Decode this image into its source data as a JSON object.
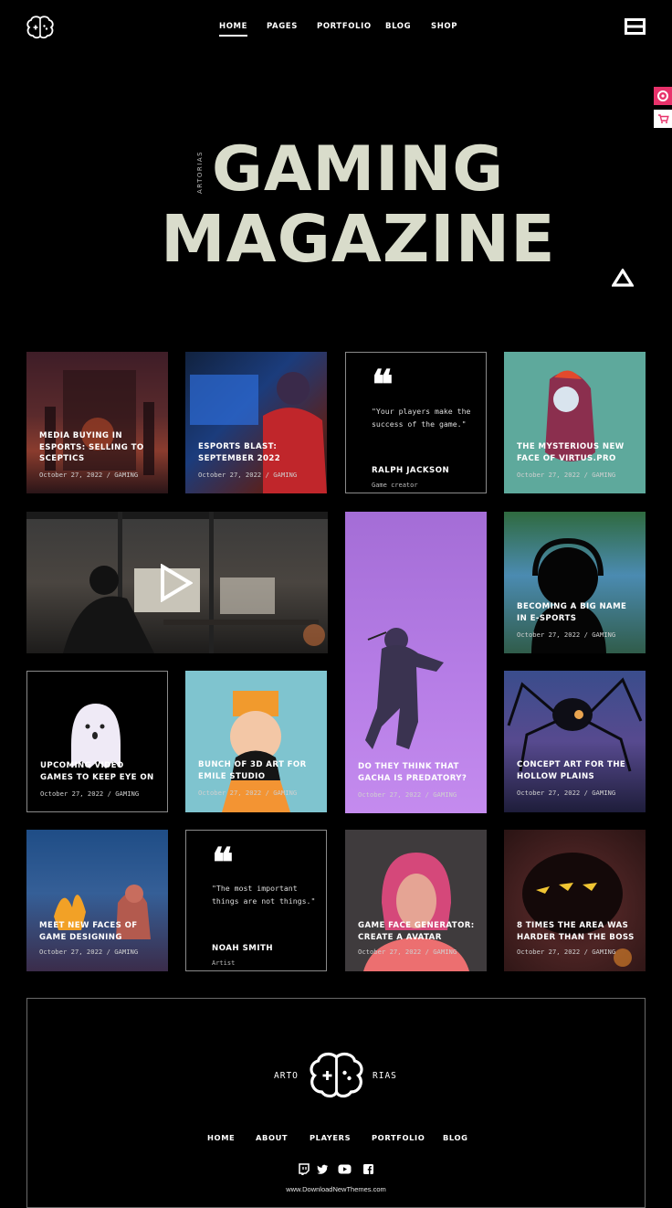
{
  "header": {
    "nav": [
      {
        "label": "HOME",
        "active": true
      },
      {
        "label": "PAGES",
        "active": false
      },
      {
        "label": "PORTFOLIO",
        "active": false
      },
      {
        "label": "BLOG",
        "active": false
      },
      {
        "label": "SHOP",
        "active": false
      }
    ]
  },
  "hero": {
    "line1": "GAMING",
    "line2": "MAGAZINE",
    "vertical_brand": "ARTORIAS"
  },
  "tiles": {
    "t1": {
      "title": "MEDIA BUYING IN ESPORTS: SELLING TO SCEPTICS",
      "meta": "October 27, 2022 / GAMING"
    },
    "t2": {
      "title": "ESPORTS BLAST: SEPTEMBER 2022",
      "meta": "October 27, 2022 / GAMING"
    },
    "q1": {
      "quote": "\"Your players make the success of the game.\"",
      "name": "RALPH JACKSON",
      "role": "Game creator"
    },
    "t4": {
      "title": "THE MYSTERIOUS NEW FACE OF VIRTUS.PRO",
      "meta": "October 27, 2022 / GAMING"
    },
    "t6": {
      "title": "BECOMING A BIG NAME IN E-SPORTS",
      "meta": "October 27, 2022 / GAMING"
    },
    "t7": {
      "title": "UPCOMING VIDEO GAMES TO KEEP EYE ON",
      "meta": "October 27, 2022 / GAMING"
    },
    "t8": {
      "title": "BUNCH OF 3D ART FOR EMILE STUDIO",
      "meta": "October 27, 2022 / GAMING"
    },
    "t9": {
      "title": "DO THEY THINK THAT GACHA IS PREDATORY?",
      "meta": "October 27, 2022 / GAMING"
    },
    "t10": {
      "title": "CONCEPT ART FOR THE HOLLOW PLAINS",
      "meta": "October 27, 2022 / GAMING"
    },
    "t11": {
      "title": "MEET NEW FACES OF GAME DESIGNING",
      "meta": "October 27, 2022 / GAMING"
    },
    "q2": {
      "quote": "\"The most important things are not things.\"",
      "name": "NOAH SMITH",
      "role": "Artist"
    },
    "t13": {
      "title": "GAME FACE GENERATOR: CREATE A AVATAR",
      "meta": "October 27, 2022 / GAMING"
    },
    "t14": {
      "title": "8 TIMES THE AREA WAS HARDER THAN THE BOSS",
      "meta": "October 27, 2022 / GAMING"
    }
  },
  "footer": {
    "brand_left": "ARTO",
    "brand_right": "RIAS",
    "nav": [
      "HOME",
      "ABOUT",
      "PLAYERS",
      "PORTFOLIO",
      "BLOG"
    ],
    "social_icons": [
      "twitch-icon",
      "twitter-icon",
      "youtube-icon",
      "facebook-icon"
    ],
    "watermark": "www.DownloadNewThemes.com"
  },
  "colors": {
    "background": "#000000",
    "accent_pink": "#e8326b",
    "hero_text": "#d9dccb"
  }
}
